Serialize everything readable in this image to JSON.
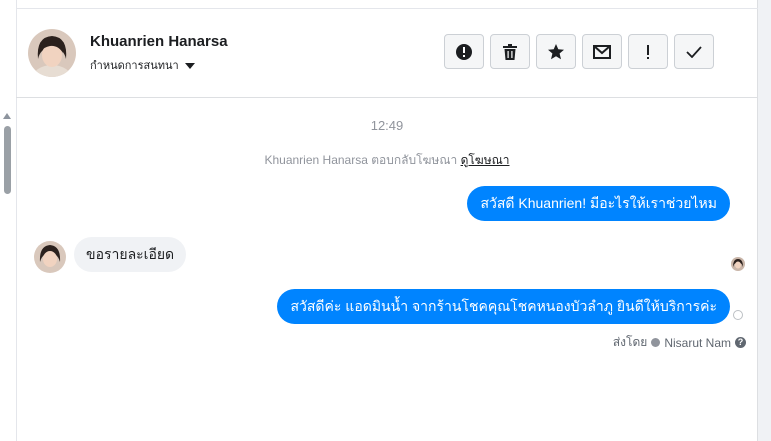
{
  "header": {
    "contact_name": "Khuanrien Hanarsa",
    "assign_label": "กำหนดการสนทนา",
    "actions": [
      {
        "icon": "alert-circle-icon",
        "label": "Mark as spam"
      },
      {
        "icon": "trash-icon",
        "label": "Delete"
      },
      {
        "icon": "star-icon",
        "label": "Follow up"
      },
      {
        "icon": "envelope-icon",
        "label": "Mark as unread"
      },
      {
        "icon": "exclamation-icon",
        "label": "Priority"
      },
      {
        "icon": "check-icon",
        "label": "Mark as done"
      }
    ]
  },
  "thread": {
    "timestamp": "12:49",
    "reply_note_prefix": "Khuanrien Hanarsa ตอบกลับโฆษณา",
    "reply_note_link": "ดูโฆษณา",
    "messages": [
      {
        "direction": "out",
        "text": "สวัสดี Khuanrien! มีอะไรให้เราช่วยไหม"
      },
      {
        "direction": "in",
        "text": "ขอรายละเอียด"
      },
      {
        "direction": "out",
        "text": "สวัสดีค่ะ แอดมินน้ำ จากร้านโชคคุณโชคหนองบัวลำภู ยินดีให้บริการค่ะ"
      }
    ],
    "sent_by_label": "ส่งโดย",
    "sent_by_name": "Nisarut Nam"
  },
  "colors": {
    "accent": "#0084ff",
    "incoming_bubble": "#f0f2f5",
    "muted_text": "#90949c"
  }
}
